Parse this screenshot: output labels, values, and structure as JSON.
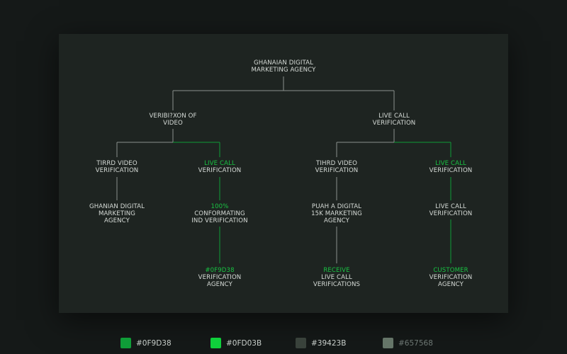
{
  "diagram": {
    "root": [
      "GHANAIAN DIGITAL",
      "MARKETING AGENCY"
    ],
    "level1": [
      [
        "VERIBI?XON OF",
        "VIDEO"
      ],
      [
        "LIVE CALL",
        "VERIFICATION"
      ]
    ],
    "level2": [
      [
        {
          "t": "TIRRD VIDEO",
          "g": false
        },
        {
          "t": "VERIFICATION",
          "g": false
        }
      ],
      [
        {
          "t": "LIVE CALL",
          "g": true
        },
        {
          "t": "VERIFICATION",
          "g": false
        }
      ],
      [
        {
          "t": "TIHRD VIDEO",
          "g": false
        },
        {
          "t": "VERIFICATION",
          "g": false
        }
      ],
      [
        {
          "t": "LIVE CALL",
          "g": true
        },
        {
          "t": "VERIFICATION",
          "g": false
        }
      ]
    ],
    "level3": [
      [
        {
          "t": "GHANIAN DIGITAL",
          "g": false
        },
        {
          "t": "MARKETING",
          "g": false
        },
        {
          "t": "AGENCY",
          "g": false
        }
      ],
      [
        {
          "t": "100%",
          "g": true
        },
        {
          "t": "CONFORMATING",
          "g": false
        },
        {
          "t": "IND VERIFICATION",
          "g": false
        }
      ],
      [
        {
          "t": "PUAH A DIGITAL",
          "g": false
        },
        {
          "t": "15K MARKETING",
          "g": false
        },
        {
          "t": "AGENCY",
          "g": false
        }
      ],
      [
        {
          "t": "LIVE CALL",
          "g": false
        },
        {
          "t": "VERIFICATION",
          "g": false
        }
      ]
    ],
    "level4": [
      [
        {
          "t": "#0F9D38",
          "g": true
        },
        {
          "t": "VERIFICATION",
          "g": false
        },
        {
          "t": "AGENCY",
          "g": false
        }
      ],
      [
        {
          "t": "RECEIVE",
          "g": true
        },
        {
          "t": "LIVE CALL",
          "g": false
        },
        {
          "t": "VERIFICATIONS",
          "g": false
        }
      ],
      [
        {
          "t": "CUSTOMER",
          "g": true
        },
        {
          "t": "VERIFICATION",
          "g": false
        },
        {
          "t": "AGENCY",
          "g": false
        }
      ]
    ]
  },
  "colors": {
    "line_gray": "#8a918d",
    "line_green": "#0f9d38",
    "text": "#d7dcd8",
    "text_green": "#19c243"
  },
  "legend": [
    {
      "label": "#0F9D38",
      "color": "#0F9D38",
      "muted": false
    },
    {
      "label": "#0FD03B",
      "color": "#0FD03B",
      "muted": false
    },
    {
      "label": "#39423B",
      "color": "#39423B",
      "muted": false
    },
    {
      "label": "#657568",
      "color": "#657568",
      "muted": true
    }
  ]
}
